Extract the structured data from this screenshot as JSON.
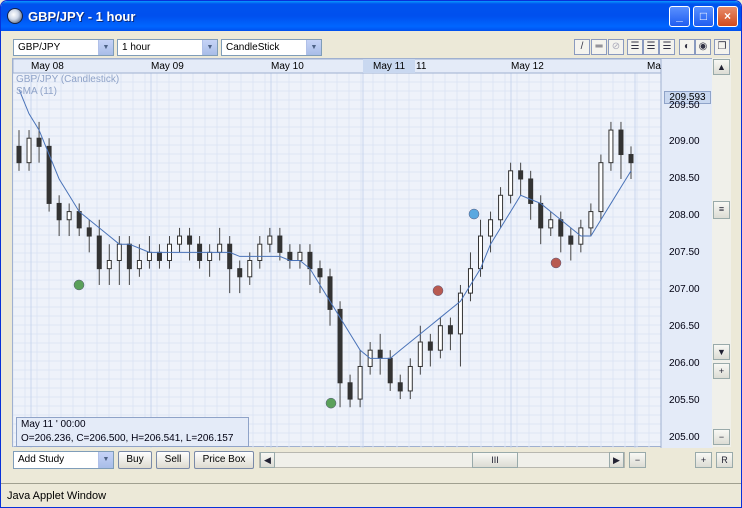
{
  "window": {
    "title": "GBP/JPY - 1 hour",
    "buttons": [
      "_",
      "□",
      "×"
    ]
  },
  "toolbar": {
    "symbol": "GBP/JPY",
    "period": "1 hour",
    "chart_type": "CandleStick"
  },
  "chart": {
    "legend": [
      "GBP/JPY (Candlestick)",
      "SMA (11)"
    ],
    "current_price": "209.593",
    "date_labels": [
      "May 08",
      "May 09",
      "May 10",
      "May 11",
      "11",
      "May 12",
      "Ma"
    ],
    "y_ticks": [
      "209.50",
      "209.00",
      "208.50",
      "208.00",
      "207.50",
      "207.00",
      "206.50",
      "206.00",
      "205.50",
      "205.00"
    ],
    "info": {
      "time": "May 11 ' 00:00",
      "ohlc": "O=206.236, C=206.500, H=206.541, L=206.157"
    },
    "colors": {
      "bull": "#333333",
      "bear": "#333333",
      "sma": "#4a73b8",
      "grid": "#c9d6ee",
      "green": "#5aa05a",
      "red": "#b85a50",
      "blue": "#5aa8e0"
    }
  },
  "chart_data": {
    "type": "candlestick",
    "ylim": [
      205.0,
      209.6
    ],
    "candles": [
      [
        208.7,
        208.5,
        208.9,
        208.4
      ],
      [
        208.5,
        208.8,
        208.9,
        208.4
      ],
      [
        208.8,
        208.7,
        209.0,
        208.5
      ],
      [
        208.7,
        208.0,
        208.8,
        207.9
      ],
      [
        208.0,
        207.8,
        208.1,
        207.6
      ],
      [
        207.8,
        207.9,
        208.0,
        207.6
      ],
      [
        207.9,
        207.7,
        208.0,
        207.6
      ],
      [
        207.7,
        207.6,
        207.8,
        207.4
      ],
      [
        207.6,
        207.2,
        207.8,
        207.0
      ],
      [
        207.2,
        207.3,
        207.5,
        207.0
      ],
      [
        207.3,
        207.5,
        207.6,
        207.0
      ],
      [
        207.5,
        207.2,
        207.6,
        207.0
      ],
      [
        207.2,
        207.3,
        207.5,
        207.1
      ],
      [
        207.3,
        207.4,
        207.6,
        207.2
      ],
      [
        207.4,
        207.3,
        207.5,
        207.2
      ],
      [
        207.3,
        207.5,
        207.6,
        207.2
      ],
      [
        207.5,
        207.6,
        207.7,
        207.4
      ],
      [
        207.6,
        207.5,
        207.7,
        207.3
      ],
      [
        207.5,
        207.3,
        207.6,
        207.2
      ],
      [
        207.3,
        207.4,
        207.5,
        207.1
      ],
      [
        207.4,
        207.5,
        207.7,
        207.3
      ],
      [
        207.5,
        207.2,
        207.6,
        206.9
      ],
      [
        207.2,
        207.1,
        207.3,
        206.9
      ],
      [
        207.1,
        207.3,
        207.4,
        207.0
      ],
      [
        207.3,
        207.5,
        207.6,
        207.2
      ],
      [
        207.5,
        207.6,
        207.7,
        207.4
      ],
      [
        207.6,
        207.4,
        207.7,
        207.3
      ],
      [
        207.4,
        207.3,
        207.5,
        207.2
      ],
      [
        207.3,
        207.4,
        207.5,
        207.2
      ],
      [
        207.4,
        207.2,
        207.5,
        207.0
      ],
      [
        207.2,
        207.1,
        207.3,
        206.9
      ],
      [
        207.1,
        206.7,
        207.2,
        206.5
      ],
      [
        206.7,
        205.8,
        206.8,
        205.5
      ],
      [
        205.8,
        205.6,
        205.9,
        205.5
      ],
      [
        205.6,
        206.0,
        206.2,
        205.5
      ],
      [
        206.0,
        206.2,
        206.3,
        205.9
      ],
      [
        206.2,
        206.1,
        206.4,
        205.9
      ],
      [
        206.1,
        205.8,
        206.2,
        205.7
      ],
      [
        205.8,
        205.7,
        205.9,
        205.6
      ],
      [
        205.7,
        206.0,
        206.1,
        205.6
      ],
      [
        206.0,
        206.3,
        206.5,
        205.9
      ],
      [
        206.3,
        206.2,
        206.4,
        206.0
      ],
      [
        206.2,
        206.5,
        206.6,
        206.1
      ],
      [
        206.5,
        206.4,
        206.6,
        206.2
      ],
      [
        206.4,
        206.9,
        207.0,
        206.0
      ],
      [
        206.9,
        207.2,
        207.4,
        206.8
      ],
      [
        207.2,
        207.6,
        207.8,
        207.1
      ],
      [
        207.6,
        207.8,
        207.9,
        207.4
      ],
      [
        207.8,
        208.1,
        208.2,
        207.7
      ],
      [
        208.1,
        208.4,
        208.5,
        208.0
      ],
      [
        208.4,
        208.3,
        208.5,
        208.1
      ],
      [
        208.3,
        208.0,
        208.4,
        207.8
      ],
      [
        208.0,
        207.7,
        208.1,
        207.5
      ],
      [
        207.7,
        207.8,
        207.9,
        207.6
      ],
      [
        207.8,
        207.6,
        207.9,
        207.4
      ],
      [
        207.6,
        207.5,
        207.7,
        207.3
      ],
      [
        207.5,
        207.7,
        207.8,
        207.4
      ],
      [
        207.7,
        207.9,
        208.0,
        207.6
      ],
      [
        207.9,
        208.5,
        208.6,
        207.8
      ],
      [
        208.5,
        208.9,
        209.0,
        208.4
      ],
      [
        208.9,
        208.6,
        209.0,
        208.3
      ],
      [
        208.6,
        208.5,
        208.7,
        208.3
      ]
    ],
    "sma_11": [
      209.4,
      209.1,
      208.9,
      208.6,
      208.3,
      208.1,
      207.9,
      207.8,
      207.7,
      207.6,
      207.5,
      207.5,
      207.45,
      207.4,
      207.4,
      207.4,
      207.4,
      207.4,
      207.4,
      207.4,
      207.4,
      207.4,
      207.35,
      207.35,
      207.35,
      207.35,
      207.35,
      207.3,
      207.3,
      207.2,
      207.0,
      206.8,
      206.6,
      206.4,
      206.2,
      206.1,
      206.1,
      206.1,
      206.2,
      206.3,
      206.4,
      206.5,
      206.6,
      206.7,
      206.8,
      207.0,
      207.2,
      207.5,
      207.7,
      207.9,
      208.1,
      208.05,
      208.0,
      207.9,
      207.8,
      207.7,
      207.6,
      207.6,
      207.8,
      208.0,
      208.2,
      208.4
    ]
  },
  "bottom": {
    "add_study": "Add Study",
    "buy": "Buy",
    "sell": "Sell",
    "price_box": "Price Box"
  },
  "status": {
    "text": "Java Applet Window"
  }
}
